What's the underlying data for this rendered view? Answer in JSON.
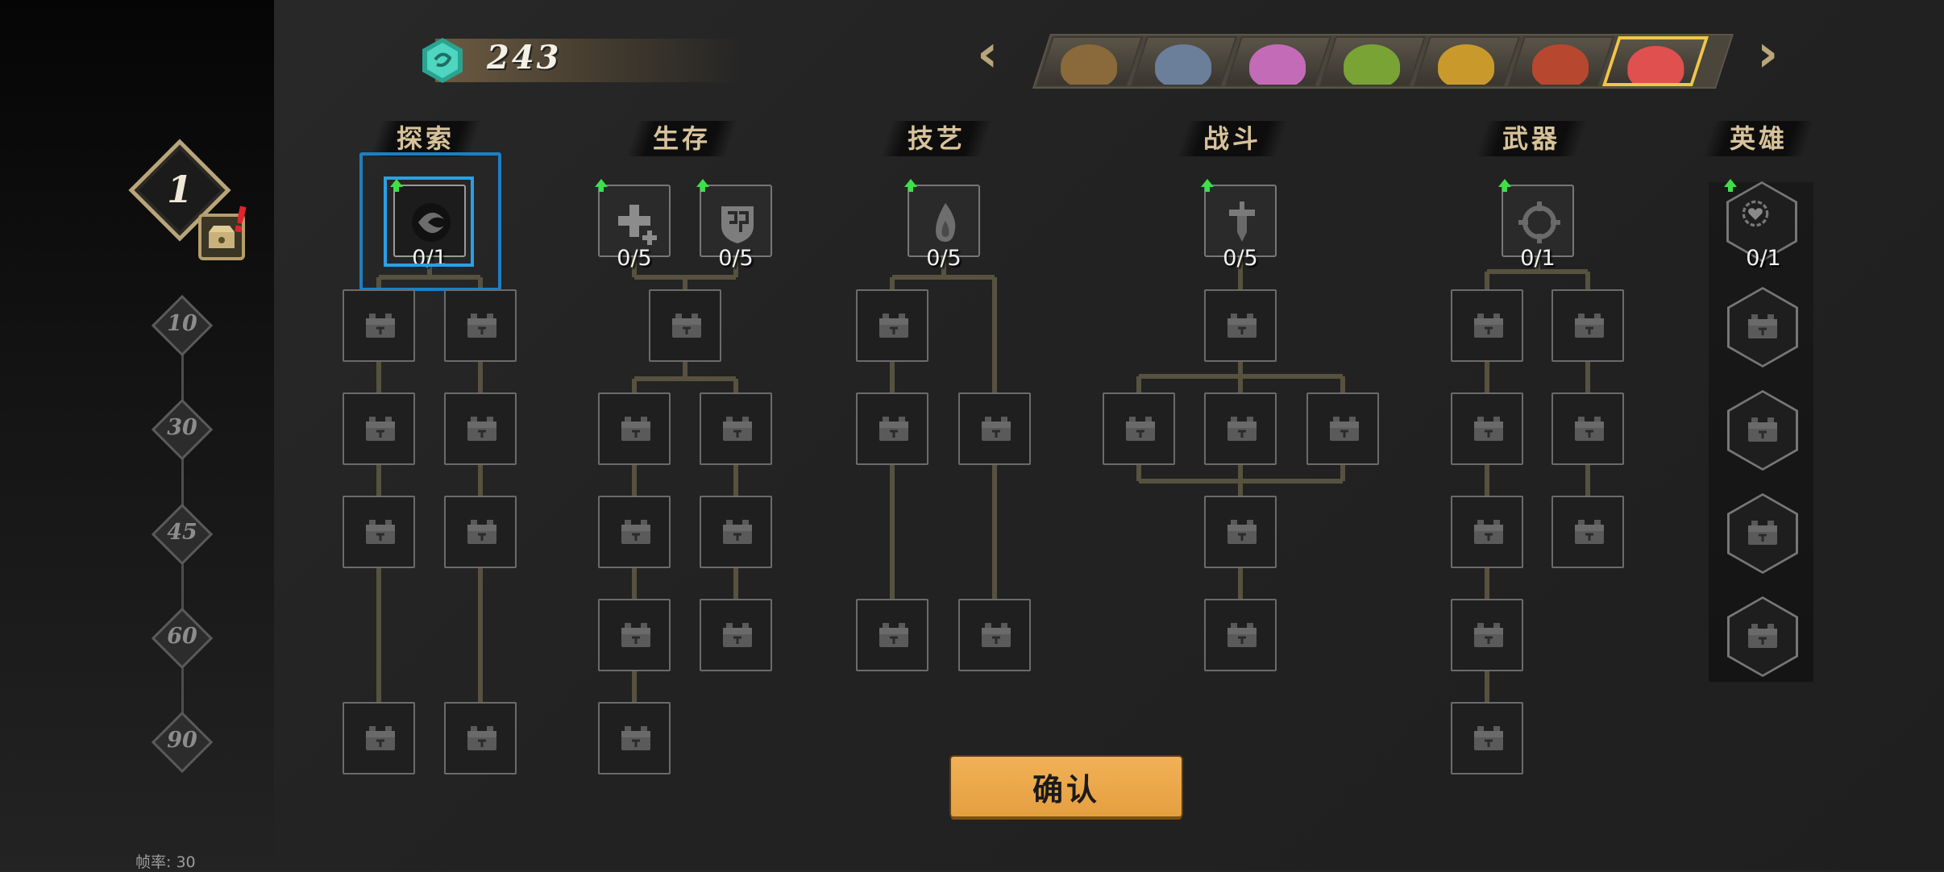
{
  "currency": {
    "count": "243",
    "icon": "teal-gem-icon",
    "color": "#3cc9b5"
  },
  "player_level": {
    "current": "1",
    "milestones": [
      "10",
      "30",
      "45",
      "60",
      "90"
    ],
    "alert": "!"
  },
  "fps_label": "帧率: 30",
  "hero_selector": {
    "prev_arrow": "‹",
    "next_arrow": "›",
    "portraits": [
      {
        "name": "hero-1",
        "color": "#8a6a3a"
      },
      {
        "name": "hero-2",
        "color": "#6b7f9a"
      },
      {
        "name": "hero-3",
        "color": "#c46bb8"
      },
      {
        "name": "hero-4",
        "color": "#7aa336"
      },
      {
        "name": "hero-5",
        "color": "#c99a2b"
      },
      {
        "name": "hero-6",
        "color": "#b7482f"
      },
      {
        "name": "hero-7",
        "color": "#e0504e",
        "selected": true
      }
    ]
  },
  "categories": [
    "探索",
    "生存",
    "技艺",
    "战斗",
    "武器",
    "英雄"
  ],
  "skills": [
    {
      "category": "探索",
      "icon": "swirl-orb-icon",
      "level": "0/1",
      "selected": true
    },
    {
      "category": "生存",
      "icon": "health-cross-icon",
      "level": "0/5"
    },
    {
      "category": "生存",
      "icon": "armor-shield-icon",
      "level": "0/5"
    },
    {
      "category": "技艺",
      "icon": "flame-icon",
      "level": "0/5"
    },
    {
      "category": "战斗",
      "icon": "sword-icon",
      "level": "0/5"
    },
    {
      "category": "武器",
      "icon": "crosshair-icon",
      "level": "0/1"
    },
    {
      "category": "英雄",
      "icon": "heart-gear-icon",
      "level": "0/1"
    }
  ],
  "locked_node_icon": "locked-chest-icon",
  "confirm_button": "确认",
  "colors": {
    "accent_gold": "#b9a57a",
    "confirm_orange": "#eba84b",
    "selection_blue": "#1d7fc2",
    "upgrade_green": "#3ee04a"
  }
}
